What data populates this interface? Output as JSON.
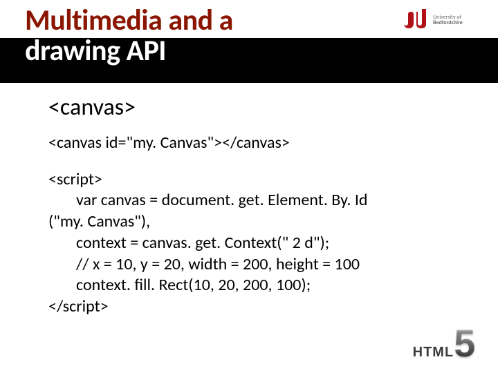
{
  "title": {
    "line1": "Multimedia and a",
    "line2": "drawing API"
  },
  "logo": {
    "alt": "University of Bedfordshire",
    "line1": "University of",
    "line2": "Bedfordshire"
  },
  "content": {
    "heading": "<canvas>",
    "example_line": "<canvas id=\"my. Canvas\"></canvas>",
    "code": {
      "l1": "<script>",
      "l2": "var canvas = document. get. Element. By. Id",
      "l3": "(\"my. Canvas\"),",
      "l4": "context = canvas. get. Context(\" 2 d\");",
      "l5": "// x = 10, y = 20, width = 200, height = 100",
      "l6": "context. fill. Rect(10, 20, 200, 100);",
      "l7": "</script>"
    }
  },
  "badge": {
    "label": "HTML",
    "number": "5"
  }
}
